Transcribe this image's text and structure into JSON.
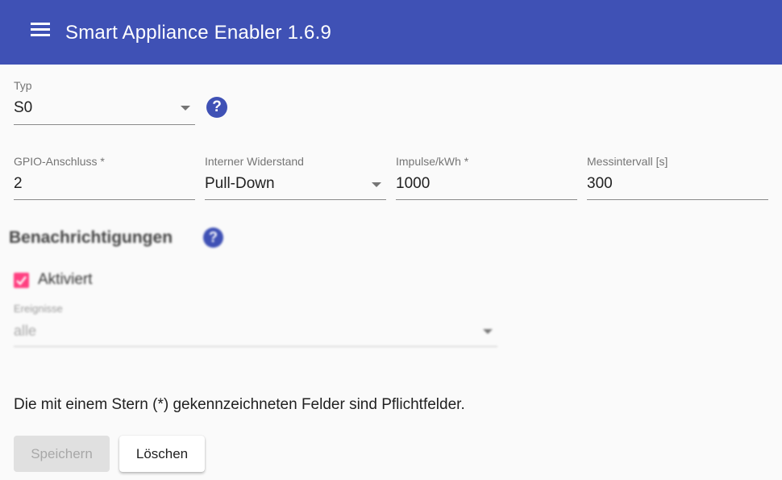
{
  "header": {
    "title": "Smart Appliance Enabler 1.6.9",
    "menu_icon": "menu-icon",
    "background": "#3f51b5"
  },
  "typ": {
    "label": "Typ",
    "value": "S0"
  },
  "help_glyph": "?",
  "gpio": {
    "label": "GPIO-Anschluss *",
    "value": "2"
  },
  "widerstand": {
    "label": "Interner Widerstand",
    "value": "Pull-Down"
  },
  "impulse": {
    "label": "Impulse/kWh *",
    "value": "1000"
  },
  "messintervall": {
    "label": "Messintervall [s]",
    "value": "300"
  },
  "notifications": {
    "title": "Benachrichtigungen",
    "enabled_label": "Aktiviert",
    "enabled": true,
    "events_label": "Ereignisse",
    "events_value": "alle"
  },
  "required_note": "Die mit einem Stern (*) gekennzeichneten Felder sind Pflichtfelder.",
  "buttons": {
    "save": "Speichern",
    "delete": "Löschen"
  },
  "colors": {
    "primary": "#3f51b5",
    "accent": "#ff4081"
  }
}
